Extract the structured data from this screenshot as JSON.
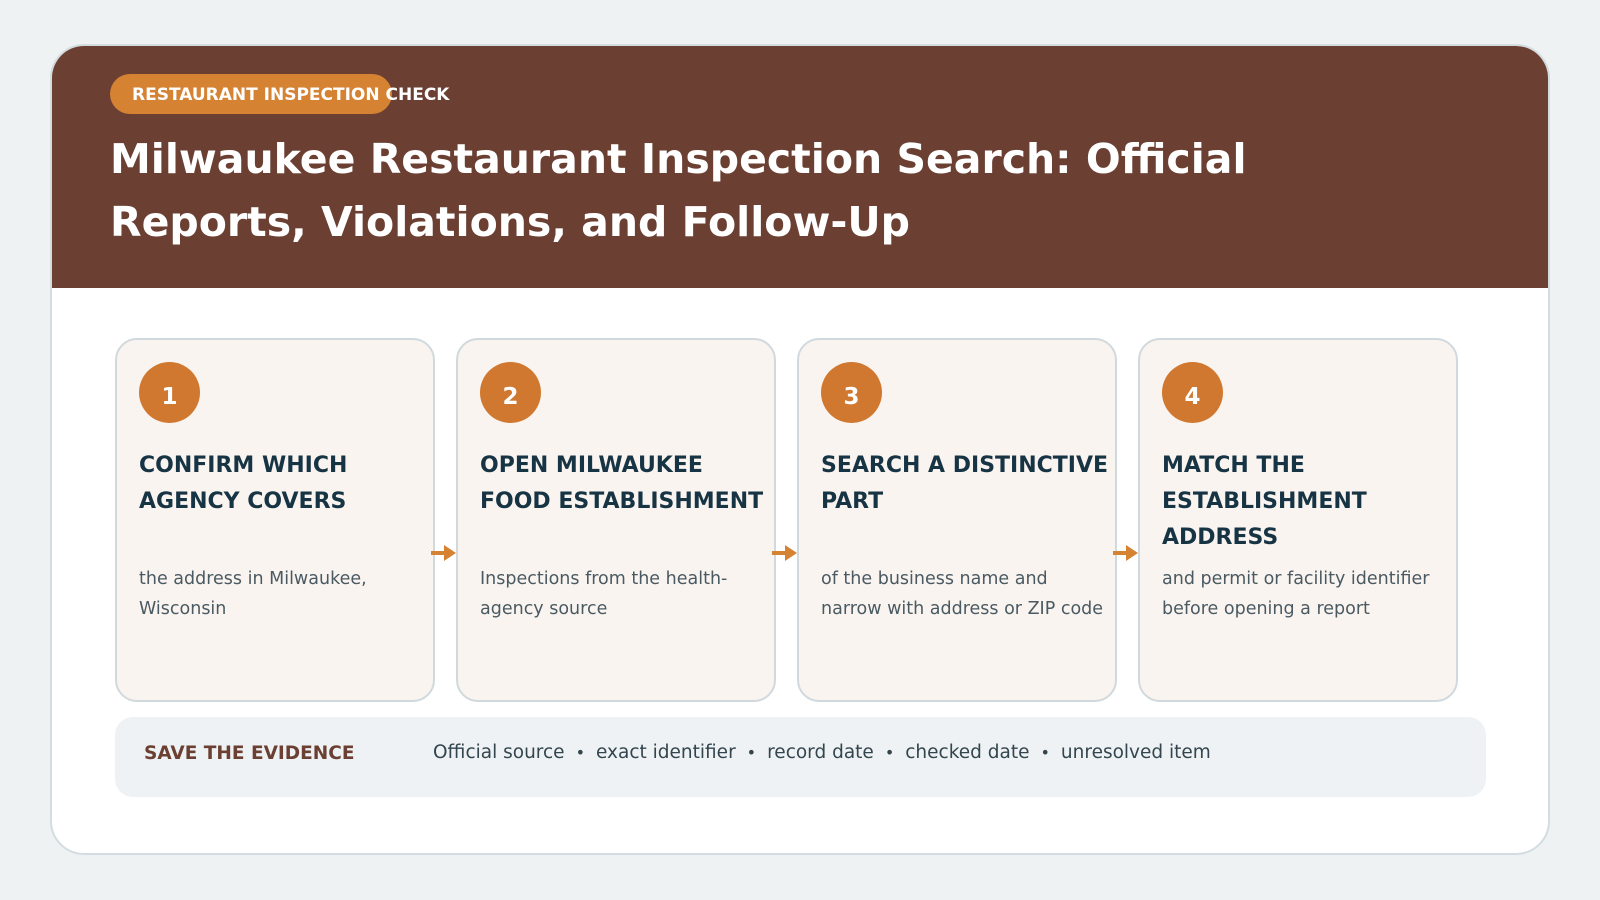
{
  "header": {
    "tag": "RESTAURANT INSPECTION CHECK",
    "title": "Milwaukee Restaurant Inspection Search: Official Reports, Violations, and Follow-Up"
  },
  "steps": [
    {
      "number": "1",
      "title": "CONFIRM WHICH AGENCY COVERS",
      "description": "the address in Milwaukee, Wisconsin"
    },
    {
      "number": "2",
      "title": "OPEN MILWAUKEE FOOD ESTABLISHMENT",
      "description": "Inspections from the health-agency source"
    },
    {
      "number": "3",
      "title": "SEARCH A DISTINCTIVE PART",
      "description": "of the business name and narrow with address or ZIP code"
    },
    {
      "number": "4",
      "title": "MATCH THE ESTABLISHMENT ADDRESS",
      "description": "and permit or facility identifier before opening a report"
    }
  ],
  "footer": {
    "label": "SAVE THE EVIDENCE",
    "items": [
      "Official source",
      "exact identifier",
      "record date",
      "checked date",
      "unresolved item"
    ],
    "separator": "•"
  },
  "colors": {
    "header_bg": "#6b4033",
    "accent": "#d68233",
    "card_bg": "#faf4f0",
    "title_text": "#173444"
  }
}
